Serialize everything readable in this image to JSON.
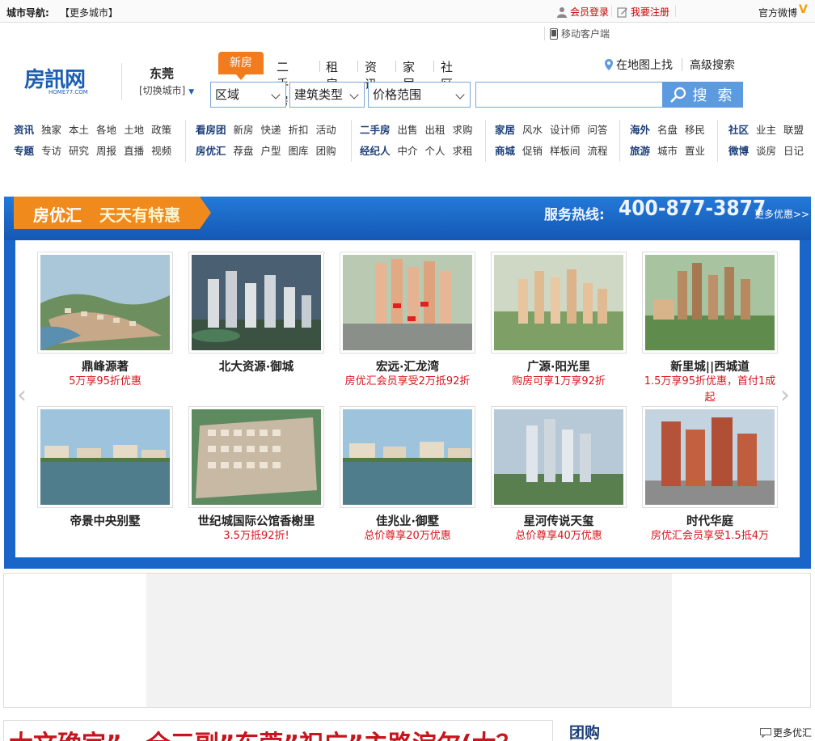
{
  "topbar": {
    "nav_title": "城市导航:",
    "more_city": "【更多城市】",
    "login": "会员登录",
    "register": "我要注册",
    "weibo": "官方微博"
  },
  "mobile_client": "移动客户端",
  "header": {
    "logo_text": "房訊网",
    "logo_sub": "HOME77.COM",
    "city": "东莞",
    "switch_city": "[切换城市]"
  },
  "main_tabs": {
    "active": "新房",
    "items": [
      "二手房",
      "租房",
      "资讯",
      "家居",
      "社区"
    ]
  },
  "map_search": "在地图上找",
  "adv_search": "高级搜索",
  "search": {
    "region": "区域",
    "building_type": "建筑类型",
    "price_range": "价格范围",
    "input_value": "",
    "button": "搜 索"
  },
  "link_groups": [
    {
      "row1": [
        "资讯",
        "独家",
        "本土",
        "各地",
        "土地",
        "政策"
      ],
      "row2": [
        "专题",
        "专访",
        "研究",
        "周报",
        "直播",
        "视频"
      ]
    },
    {
      "row1": [
        "看房团",
        "新房",
        "快递",
        "折扣",
        "活动"
      ],
      "row2": [
        "房优汇",
        "荐盘",
        "户型",
        "图库",
        "团购"
      ]
    },
    {
      "row1": [
        "二手房",
        "出售",
        "出租",
        "求购"
      ],
      "row2": [
        "经纪人",
        "中介",
        "个人",
        "求租"
      ]
    },
    {
      "row1": [
        "家居",
        "风水",
        "设计师",
        "问答"
      ],
      "row2": [
        "商城",
        "促销",
        "样板间",
        "流程"
      ]
    },
    {
      "row1": [
        "海外",
        "名盘",
        "移民"
      ],
      "row2": [
        "旅游",
        "城市",
        "置业"
      ]
    },
    {
      "row1": [
        "社区",
        "业主",
        "联盟"
      ],
      "row2": [
        "微博",
        "谈房",
        "日记"
      ]
    }
  ],
  "promo": {
    "tag_main": "房优汇",
    "tag_sub": "天天有特惠",
    "hotline_label": "服务热线:",
    "hotline_number": "400-877-3877",
    "more": "更多优惠>>",
    "cards": [
      {
        "name": "鼎峰源著",
        "deal": "5万享95折优惠"
      },
      {
        "name": "北大资源·御城",
        "deal": ""
      },
      {
        "name": "宏远·汇龙湾",
        "deal": "房优汇会员享受2万抵92折"
      },
      {
        "name": "广源·阳光里",
        "deal": "购房可享1万享92折"
      },
      {
        "name": "新里城||西城道",
        "deal": "1.5万享95折优惠，首付1成起"
      },
      {
        "name": "帝景中央别墅",
        "deal": ""
      },
      {
        "name": "世纪城国际公馆香榭里",
        "deal": "3.5万抵92折!"
      },
      {
        "name": "佳兆业·御墅",
        "deal": "总价尊享20万优惠"
      },
      {
        "name": "星河传说天玺",
        "deal": "总价尊享40万优惠"
      },
      {
        "name": "时代华庭",
        "deal": "房优汇会员享受1.5抵4万"
      }
    ]
  },
  "bottom": {
    "headline": "大文确定”，全三副”东莞”祝广”主路淀尔(大？",
    "group_buy": "团购",
    "more": "更多优汇"
  },
  "colors": {
    "brand_blue": "#1b5fb5",
    "orange": "#f27b1d",
    "promo_blue": "#1a66c8",
    "deal_red": "#d8141c"
  }
}
